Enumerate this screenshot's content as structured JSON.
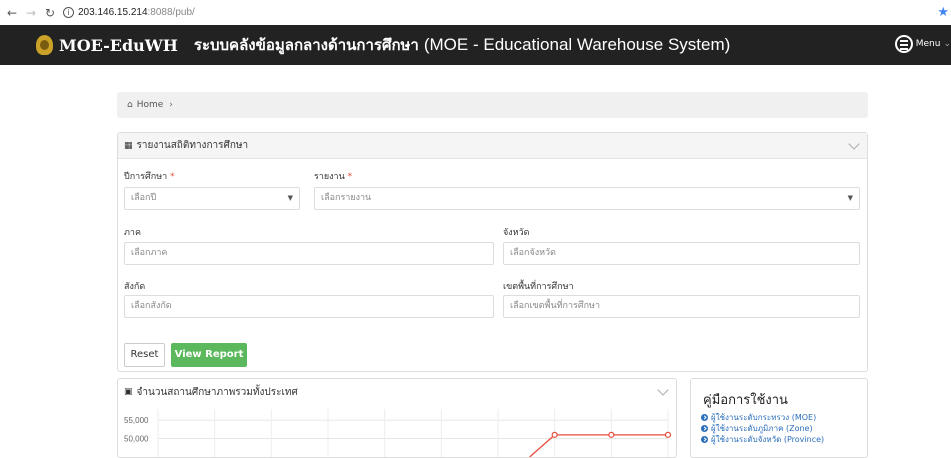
{
  "browser": {
    "url_host": "203.146.15.214",
    "url_rest": ":8088/pub/"
  },
  "navbar": {
    "brand": "MOE-EduWH",
    "title_th": "ระบบคลังข้อมูลกลางด้านการศึกษา",
    "title_en": "(MOE - Educational Warehouse System)",
    "menu_label": "Menu"
  },
  "breadcrumb": {
    "home": "Home",
    "separator": "›"
  },
  "report_panel": {
    "title": "รายงานสถิติทางการศึกษา",
    "fields": {
      "year": {
        "label": "ปีการศึกษา",
        "placeholder": "เลือกปี"
      },
      "report": {
        "label": "รายงาน",
        "placeholder": "เลือกรายงาน"
      },
      "region": {
        "label": "ภาค",
        "placeholder": "เลือกภาค"
      },
      "province": {
        "label": "จังหวัด",
        "placeholder": "เลือกจังหวัด"
      },
      "affiliation": {
        "label": "สังกัด",
        "placeholder": "เลือกสังกัด"
      },
      "area": {
        "label": "เขตพื้นที่การศึกษา",
        "placeholder": "เลือกเขตพื้นที่การศึกษา"
      }
    },
    "required_mark": "*",
    "reset_label": "Reset",
    "view_label": "View Report"
  },
  "chart_panel": {
    "title": "จำนวนสถานศึกษาภาพรวมทั้งประเทศ"
  },
  "chart_data": {
    "type": "line",
    "title": "",
    "y_ticks": [
      "55,000",
      "50,000"
    ],
    "series": [
      {
        "values": [
          null,
          null,
          null,
          null,
          null,
          null,
          null,
          51000,
          51000,
          51000
        ]
      }
    ],
    "ylim": [
      45000,
      58000
    ],
    "grid": true,
    "line_color": "#e74c3c"
  },
  "manual_panel": {
    "title": "คู่มือการใช้งาน",
    "links": [
      "ผู้ใช้งานระดับกระทรวง (MOE)",
      "ผู้ใช้งานระดับภูมิภาค (Zone)",
      "ผู้ใช้งานระดับจังหวัด (Province)"
    ]
  }
}
